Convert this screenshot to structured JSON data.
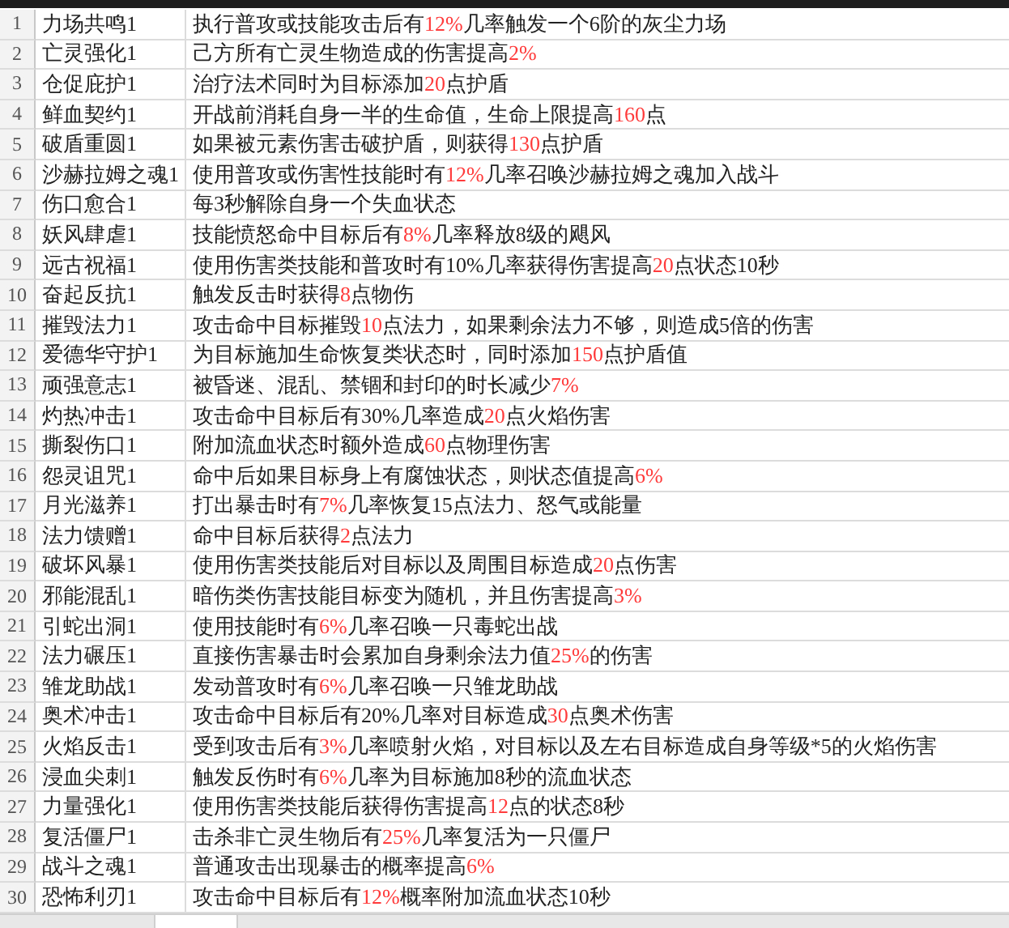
{
  "rows": [
    {
      "number": "1",
      "name": "力场共鸣1",
      "effect": [
        {
          "text": "执行普攻或技能攻击后有",
          "highlight": false
        },
        {
          "text": "12%",
          "highlight": true
        },
        {
          "text": "几率触发一个6阶的灰尘力场",
          "highlight": false
        }
      ]
    },
    {
      "number": "2",
      "name": "亡灵强化1",
      "effect": [
        {
          "text": "己方所有亡灵生物造成的伤害提高",
          "highlight": false
        },
        {
          "text": "2%",
          "highlight": true
        }
      ]
    },
    {
      "number": "3",
      "name": "仓促庇护1",
      "effect": [
        {
          "text": "治疗法术同时为目标添加",
          "highlight": false
        },
        {
          "text": "20",
          "highlight": true
        },
        {
          "text": "点护盾",
          "highlight": false
        }
      ]
    },
    {
      "number": "4",
      "name": "鲜血契约1",
      "effect": [
        {
          "text": "开战前消耗自身一半的生命值，生命上限提高",
          "highlight": false
        },
        {
          "text": "160",
          "highlight": true
        },
        {
          "text": "点",
          "highlight": false
        }
      ]
    },
    {
      "number": "5",
      "name": "破盾重圆1",
      "effect": [
        {
          "text": "如果被元素伤害击破护盾，则获得",
          "highlight": false
        },
        {
          "text": "130",
          "highlight": true
        },
        {
          "text": "点护盾",
          "highlight": false
        }
      ]
    },
    {
      "number": "6",
      "name": "沙赫拉姆之魂1",
      "effect": [
        {
          "text": "使用普攻或伤害性技能时有",
          "highlight": false
        },
        {
          "text": "12%",
          "highlight": true
        },
        {
          "text": "几率召唤沙赫拉姆之魂加入战斗",
          "highlight": false
        }
      ]
    },
    {
      "number": "7",
      "name": "伤口愈合1",
      "effect": [
        {
          "text": "每3秒解除自身一个失血状态",
          "highlight": false
        }
      ]
    },
    {
      "number": "8",
      "name": "妖风肆虐1",
      "effect": [
        {
          "text": "技能愤怒命中目标后有",
          "highlight": false
        },
        {
          "text": "8%",
          "highlight": true
        },
        {
          "text": "几率释放8级的飓风",
          "highlight": false
        }
      ]
    },
    {
      "number": "9",
      "name": "远古祝福1",
      "effect": [
        {
          "text": "使用伤害类技能和普攻时有10%几率获得伤害提高",
          "highlight": false
        },
        {
          "text": "20",
          "highlight": true
        },
        {
          "text": "点状态10秒",
          "highlight": false
        }
      ]
    },
    {
      "number": "10",
      "name": "奋起反抗1",
      "effect": [
        {
          "text": "触发反击时获得",
          "highlight": false
        },
        {
          "text": "8",
          "highlight": true
        },
        {
          "text": "点物伤",
          "highlight": false
        }
      ]
    },
    {
      "number": "11",
      "name": "摧毁法力1",
      "effect": [
        {
          "text": "攻击命中目标摧毁",
          "highlight": false
        },
        {
          "text": "10",
          "highlight": true
        },
        {
          "text": "点法力，如果剩余法力不够，则造成5倍的伤害",
          "highlight": false
        }
      ]
    },
    {
      "number": "12",
      "name": "爱德华守护1",
      "effect": [
        {
          "text": "为目标施加生命恢复类状态时，同时添加",
          "highlight": false
        },
        {
          "text": "150",
          "highlight": true
        },
        {
          "text": "点护盾值",
          "highlight": false
        }
      ]
    },
    {
      "number": "13",
      "name": "顽强意志1",
      "effect": [
        {
          "text": "被昏迷、混乱、禁锢和封印的时长减少",
          "highlight": false
        },
        {
          "text": "7%",
          "highlight": true
        }
      ]
    },
    {
      "number": "14",
      "name": "灼热冲击1",
      "effect": [
        {
          "text": "攻击命中目标后有30%几率造成",
          "highlight": false
        },
        {
          "text": "20",
          "highlight": true
        },
        {
          "text": "点火焰伤害",
          "highlight": false
        }
      ]
    },
    {
      "number": "15",
      "name": "撕裂伤口1",
      "effect": [
        {
          "text": "附加流血状态时额外造成",
          "highlight": false
        },
        {
          "text": "60",
          "highlight": true
        },
        {
          "text": "点物理伤害",
          "highlight": false
        }
      ]
    },
    {
      "number": "16",
      "name": "怨灵诅咒1",
      "effect": [
        {
          "text": "命中后如果目标身上有腐蚀状态，则状态值提高",
          "highlight": false
        },
        {
          "text": "6%",
          "highlight": true
        }
      ]
    },
    {
      "number": "17",
      "name": "月光滋养1",
      "effect": [
        {
          "text": "打出暴击时有",
          "highlight": false
        },
        {
          "text": "7%",
          "highlight": true
        },
        {
          "text": "几率恢复15点法力、怒气或能量",
          "highlight": false
        }
      ]
    },
    {
      "number": "18",
      "name": "法力馈赠1",
      "effect": [
        {
          "text": "命中目标后获得",
          "highlight": false
        },
        {
          "text": "2",
          "highlight": true
        },
        {
          "text": "点法力",
          "highlight": false
        }
      ]
    },
    {
      "number": "19",
      "name": "破坏风暴1",
      "effect": [
        {
          "text": "使用伤害类技能后对目标以及周围目标造成",
          "highlight": false
        },
        {
          "text": "20",
          "highlight": true
        },
        {
          "text": "点伤害",
          "highlight": false
        }
      ]
    },
    {
      "number": "20",
      "name": "邪能混乱1",
      "effect": [
        {
          "text": "暗伤类伤害技能目标变为随机，并且伤害提高",
          "highlight": false
        },
        {
          "text": "3%",
          "highlight": true
        }
      ]
    },
    {
      "number": "21",
      "name": "引蛇出洞1",
      "effect": [
        {
          "text": "使用技能时有",
          "highlight": false
        },
        {
          "text": "6%",
          "highlight": true
        },
        {
          "text": "几率召唤一只毒蛇出战",
          "highlight": false
        }
      ]
    },
    {
      "number": "22",
      "name": "法力碾压1",
      "effect": [
        {
          "text": "直接伤害暴击时会累加自身剩余法力值",
          "highlight": false
        },
        {
          "text": "25%",
          "highlight": true
        },
        {
          "text": "的伤害",
          "highlight": false
        }
      ]
    },
    {
      "number": "23",
      "name": "雏龙助战1",
      "effect": [
        {
          "text": "发动普攻时有",
          "highlight": false
        },
        {
          "text": "6%",
          "highlight": true
        },
        {
          "text": "几率召唤一只雏龙助战",
          "highlight": false
        }
      ]
    },
    {
      "number": "24",
      "name": "奥术冲击1",
      "effect": [
        {
          "text": "攻击命中目标后有20%几率对目标造成",
          "highlight": false
        },
        {
          "text": "30",
          "highlight": true
        },
        {
          "text": "点奥术伤害",
          "highlight": false
        }
      ]
    },
    {
      "number": "25",
      "name": "火焰反击1",
      "effect": [
        {
          "text": "受到攻击后有",
          "highlight": false
        },
        {
          "text": "3%",
          "highlight": true
        },
        {
          "text": "几率喷射火焰，对目标以及左右目标造成自身等级*5的火焰伤害",
          "highlight": false
        }
      ]
    },
    {
      "number": "26",
      "name": "浸血尖刺1",
      "effect": [
        {
          "text": "触发反伤时有",
          "highlight": false
        },
        {
          "text": "6%",
          "highlight": true
        },
        {
          "text": "几率为目标施加8秒的流血状态",
          "highlight": false
        }
      ]
    },
    {
      "number": "27",
      "name": "力量强化1",
      "effect": [
        {
          "text": "使用伤害类技能后获得伤害提高",
          "highlight": false
        },
        {
          "text": "12",
          "highlight": true
        },
        {
          "text": "点的状态8秒",
          "highlight": false
        }
      ]
    },
    {
      "number": "28",
      "name": "复活僵尸1",
      "effect": [
        {
          "text": "击杀非亡灵生物后有",
          "highlight": false
        },
        {
          "text": "25%",
          "highlight": true
        },
        {
          "text": "几率复活为一只僵尸",
          "highlight": false
        }
      ]
    },
    {
      "number": "29",
      "name": "战斗之魂1",
      "effect": [
        {
          "text": "普通攻击出现暴击的概率提高",
          "highlight": false
        },
        {
          "text": "6%",
          "highlight": true
        }
      ]
    },
    {
      "number": "30",
      "name": "恐怖利刃1",
      "effect": [
        {
          "text": "攻击命中目标后有",
          "highlight": false
        },
        {
          "text": "12%",
          "highlight": true
        },
        {
          "text": "概率附加流血状态10秒",
          "highlight": false
        }
      ]
    }
  ]
}
